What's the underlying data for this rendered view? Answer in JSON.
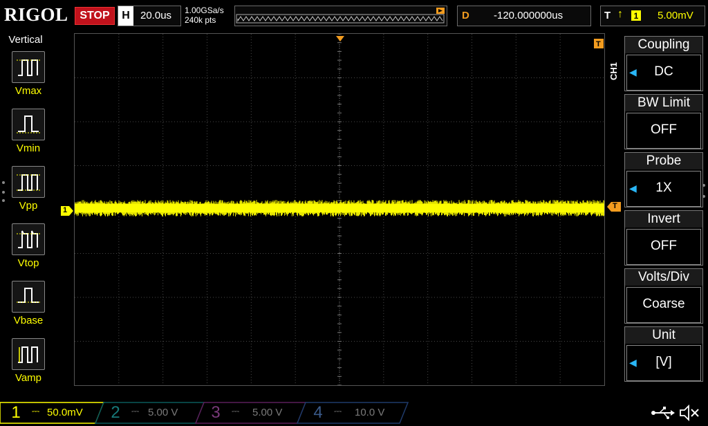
{
  "top": {
    "logo": "RIGOL",
    "run_state": "STOP",
    "timebase_key": "H",
    "timebase_value": "20.0us",
    "sample_rate": "1.00GSa/s",
    "memory_depth": "240k pts",
    "delay_key": "D",
    "delay_value": "-120.000000us",
    "trigger_key": "T",
    "trigger_edge_icon": "rising-edge-icon",
    "trigger_source": "1",
    "trigger_level": "5.00mV"
  },
  "left_panel": {
    "title": "Vertical",
    "items": [
      {
        "label": "Vmax",
        "icon": "vmax-icon"
      },
      {
        "label": "Vmin",
        "icon": "vmin-icon"
      },
      {
        "label": "Vpp",
        "icon": "vpp-icon"
      },
      {
        "label": "Vtop",
        "icon": "vtop-icon"
      },
      {
        "label": "Vbase",
        "icon": "vbase-icon"
      },
      {
        "label": "Vamp",
        "icon": "vamp-icon"
      }
    ]
  },
  "waveform": {
    "channel_marker": "1",
    "trigger_marker": "T",
    "color": "#ffff00"
  },
  "right_menu": {
    "channel_tag": "CH1",
    "items": [
      {
        "title": "Coupling",
        "value": "DC",
        "has_arrow": true
      },
      {
        "title": "BW Limit",
        "value": "OFF",
        "has_arrow": false
      },
      {
        "title": "Probe",
        "value": "1X",
        "has_arrow": true
      },
      {
        "title": "Invert",
        "value": "OFF",
        "has_arrow": false
      },
      {
        "title": "Volts/Div",
        "value": "Coarse",
        "has_arrow": false
      },
      {
        "title": "Unit",
        "value": "[V]",
        "has_arrow": true
      }
    ]
  },
  "bottom": {
    "channels": [
      {
        "num": "1",
        "scale": "50.0mV",
        "color": "#ffff00",
        "active": true
      },
      {
        "num": "2",
        "scale": "5.00 V",
        "color": "#00e5e5",
        "active": false
      },
      {
        "num": "3",
        "scale": "5.00 V",
        "color": "#e040fb",
        "active": false
      },
      {
        "num": "4",
        "scale": "10.0 V",
        "color": "#3f7fff",
        "active": false
      }
    ],
    "status_icons": [
      "usb-icon",
      "speaker-muted-icon"
    ]
  }
}
